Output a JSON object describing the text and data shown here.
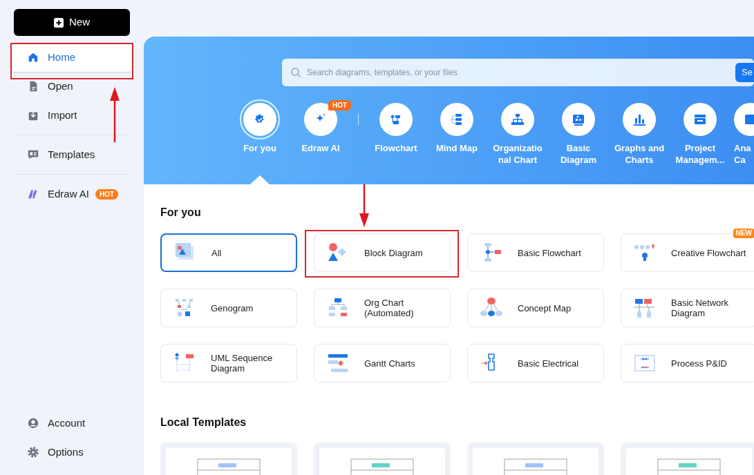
{
  "sidebar": {
    "new_button": "New",
    "items": [
      {
        "label": "Home",
        "selected": true
      },
      {
        "label": "Open",
        "selected": false
      },
      {
        "label": "Import",
        "selected": false
      },
      {
        "label": "Templates",
        "selected": false
      },
      {
        "label": "Edraw AI",
        "selected": false,
        "badge": "HOT"
      }
    ],
    "bottom_items": [
      {
        "label": "Account"
      },
      {
        "label": "Options"
      }
    ]
  },
  "search": {
    "placeholder": "Search diagrams, templates, or your files",
    "button": "Se"
  },
  "categories": [
    {
      "label": "For you",
      "selected": true,
      "divider_after": false
    },
    {
      "label": "Edraw AI",
      "selected": false,
      "badge": "HOT",
      "divider_after": true
    },
    {
      "label": "Flowchart",
      "selected": false,
      "divider_after": false
    },
    {
      "label": "Mind Map",
      "selected": false,
      "divider_after": false
    },
    {
      "label": "Organizatio nal Chart",
      "selected": false,
      "divider_after": false
    },
    {
      "label": "Basic Diagram",
      "selected": false,
      "divider_after": false
    },
    {
      "label": "Graphs and Charts",
      "selected": false,
      "divider_after": false
    },
    {
      "label": "Project Managem...",
      "selected": false,
      "divider_after": false
    },
    {
      "label": "Ana Ca",
      "selected": false,
      "divider_after": false
    }
  ],
  "for_you": {
    "title": "For you",
    "cards": [
      {
        "label": "All",
        "selected": true
      },
      {
        "label": "Block Diagram",
        "selected": false
      },
      {
        "label": "Basic Flowchart",
        "selected": false
      },
      {
        "label": "Creative Flowchart",
        "selected": false,
        "badge": "NEW"
      },
      {
        "label": "Genogram",
        "selected": false
      },
      {
        "label": "Org Chart (Automated)",
        "selected": false
      },
      {
        "label": "Concept Map",
        "selected": false
      },
      {
        "label": "Basic Network Diagram",
        "selected": false
      },
      {
        "label": "UML Sequence Diagram",
        "selected": false
      },
      {
        "label": "Gantt Charts",
        "selected": false
      },
      {
        "label": "Basic Electrical",
        "selected": false
      },
      {
        "label": "Process P&ID",
        "selected": false
      }
    ]
  },
  "local_templates": {
    "title": "Local Templates"
  }
}
